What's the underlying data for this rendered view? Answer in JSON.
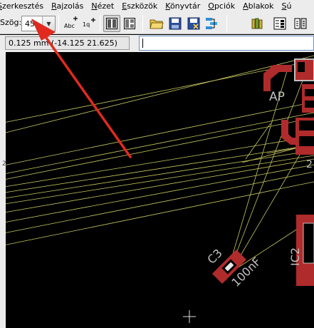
{
  "menu": {
    "items": [
      "Szerkesztés",
      "Rajzolás",
      "Nézet",
      "Eszközök",
      "Könyvtár",
      "Opciók",
      "Ablakok",
      "Sú"
    ]
  },
  "toolbar": {
    "angle_label": "Szög:",
    "angle_value": "45",
    "buttons": [
      "abc-plus",
      "label-plus",
      "grid-view",
      "grid-view-alt",
      "open-folder",
      "save-disk",
      "save-as-disk",
      "layers",
      "library-books",
      "properties",
      "mirror"
    ]
  },
  "coordbar": {
    "coordinates": "0.125 mm (-14.125 21.625)",
    "command_value": ""
  },
  "canvas": {
    "labels": {
      "c3_name": "C3",
      "c3_value": "100nF",
      "ic2_name": "IC2",
      "ap_label": "AP",
      "side_number": "2",
      "side_tick": "2"
    }
  },
  "colors": {
    "background": "#000000",
    "airwire": "#c8c860",
    "pad": "#b02b2b",
    "silkscreen": "#c0c0c0",
    "annotation": "#e02a1e",
    "chrome": "#ececec"
  }
}
